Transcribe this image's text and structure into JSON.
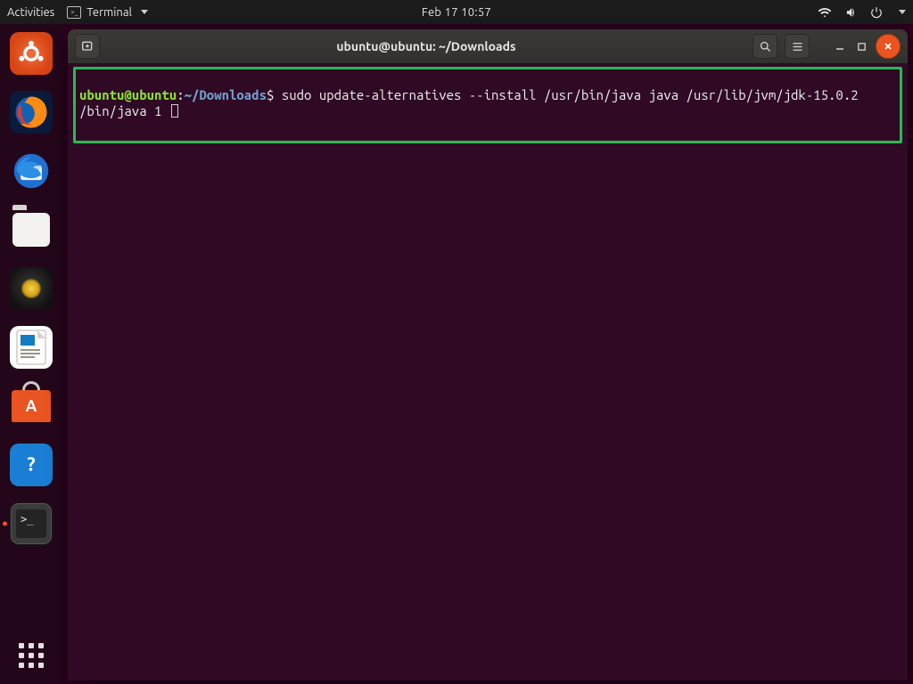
{
  "panel": {
    "activities": "Activities",
    "app_menu_label": "Terminal",
    "datetime": "Feb 17  10:57"
  },
  "dock": {
    "items": [
      {
        "name": "ubuntu-launcher"
      },
      {
        "name": "firefox-launcher"
      },
      {
        "name": "thunderbird-launcher"
      },
      {
        "name": "files-launcher"
      },
      {
        "name": "rhythmbox-launcher"
      },
      {
        "name": "libreoffice-writer-launcher"
      },
      {
        "name": "software-launcher"
      },
      {
        "name": "help-launcher"
      },
      {
        "name": "terminal-launcher",
        "running": true
      }
    ]
  },
  "window": {
    "title": "ubuntu@ubuntu: ~/Downloads"
  },
  "terminal": {
    "prompt": {
      "user_host": "ubuntu@ubuntu",
      "sep": ":",
      "cwd": "~/Downloads",
      "sigil": "$"
    },
    "command_line1": " sudo update-alternatives --install /usr/bin/java java /usr/lib/jvm/jdk-15.0.2",
    "command_line2": "/bin/java 1 "
  }
}
